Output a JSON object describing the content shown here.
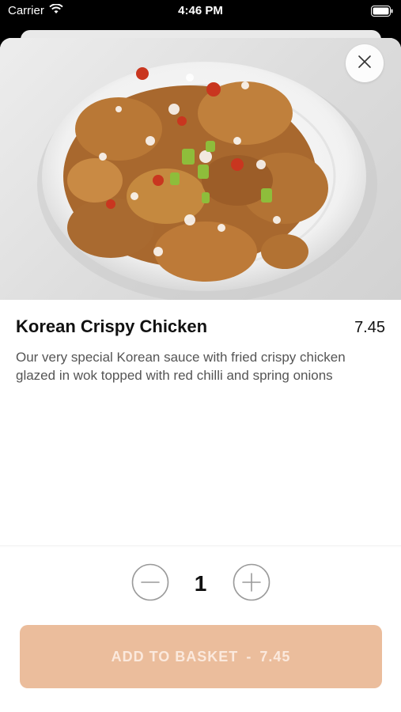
{
  "status_bar": {
    "carrier": "Carrier",
    "time": "4:46 PM",
    "wifi_icon": "wifi-icon",
    "battery_icon": "battery-icon"
  },
  "item": {
    "image_description_icon": "food-photo",
    "name": "Korean Crispy Chicken",
    "price": "7.45",
    "description": "Our very special Korean sauce with fried crispy chicken glazed in wok topped with red chilli and spring onions"
  },
  "quantity": {
    "value": "1",
    "decrement_icon": "minus-circle-icon",
    "increment_icon": "plus-circle-icon"
  },
  "add_button": {
    "label": "ADD TO BASKET",
    "separator": "-",
    "price": "7.45"
  },
  "colors": {
    "accent": "#ebbd9c",
    "accent_text": "#fbe9dd",
    "text_primary": "#111111",
    "text_secondary": "#555555"
  }
}
